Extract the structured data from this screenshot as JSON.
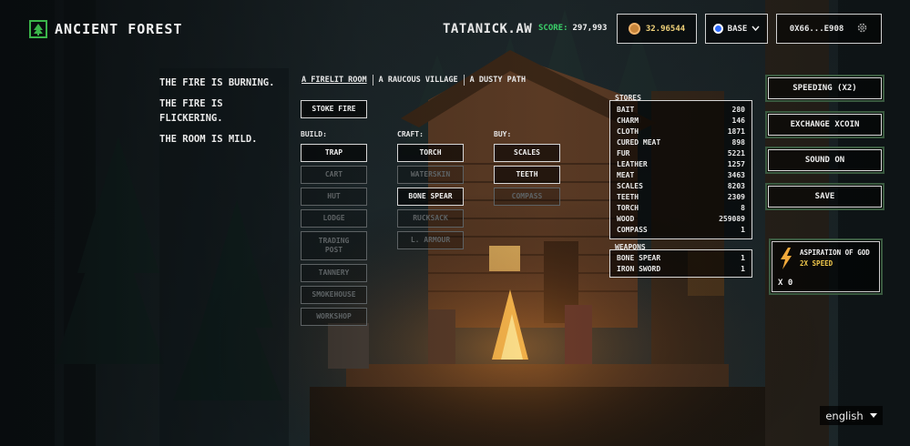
{
  "header": {
    "game_title": "ANCIENT FOREST",
    "username": "TATANICK.AW",
    "score_label": "SCORE:",
    "score_value": "297,993",
    "balance": "32.96544",
    "network": "BASE",
    "wallet": "0X66...E908",
    "icons": {
      "logo": "tree-icon",
      "coin": "coin-icon",
      "network": "base-network-icon",
      "dropdown": "chevron-down-icon",
      "settings": "gear-icon"
    }
  },
  "notes": [
    "THE FIRE IS BURNING.",
    "THE FIRE IS FLICKERING.",
    "THE ROOM IS MILD."
  ],
  "tabs": [
    {
      "label": "A FIRELIT ROOM",
      "active": true
    },
    {
      "label": "A RAUCOUS VILLAGE",
      "active": false
    },
    {
      "label": "A DUSTY PATH",
      "active": false
    }
  ],
  "actions": {
    "stoke_fire": "STOKE FIRE"
  },
  "build": {
    "label": "BUILD:",
    "items": [
      {
        "label": "TRAP",
        "enabled": true
      },
      {
        "label": "CART",
        "enabled": false
      },
      {
        "label": "HUT",
        "enabled": false
      },
      {
        "label": "LODGE",
        "enabled": false
      },
      {
        "label": "TRADING POST",
        "enabled": false
      },
      {
        "label": "TANNERY",
        "enabled": false
      },
      {
        "label": "SMOKEHOUSE",
        "enabled": false
      },
      {
        "label": "WORKSHOP",
        "enabled": false
      }
    ]
  },
  "craft": {
    "label": "CRAFT:",
    "items": [
      {
        "label": "TORCH",
        "enabled": true
      },
      {
        "label": "WATERSKIN",
        "enabled": false
      },
      {
        "label": "BONE SPEAR",
        "enabled": true
      },
      {
        "label": "RUCKSACK",
        "enabled": false
      },
      {
        "label": "L. ARMOUR",
        "enabled": false
      }
    ]
  },
  "buy": {
    "label": "BUY:",
    "items": [
      {
        "label": "SCALES",
        "enabled": true
      },
      {
        "label": "TEETH",
        "enabled": true
      },
      {
        "label": "COMPASS",
        "enabled": false
      }
    ]
  },
  "stores": {
    "title": "STORES",
    "items": [
      {
        "name": "BAIT",
        "qty": "280"
      },
      {
        "name": "CHARM",
        "qty": "146"
      },
      {
        "name": "CLOTH",
        "qty": "1871"
      },
      {
        "name": "CURED MEAT",
        "qty": "898"
      },
      {
        "name": "FUR",
        "qty": "5221"
      },
      {
        "name": "LEATHER",
        "qty": "1257"
      },
      {
        "name": "MEAT",
        "qty": "3463"
      },
      {
        "name": "SCALES",
        "qty": "8203"
      },
      {
        "name": "TEETH",
        "qty": "2309"
      },
      {
        "name": "TORCH",
        "qty": "8"
      },
      {
        "name": "WOOD",
        "qty": "259089"
      },
      {
        "name": "COMPASS",
        "qty": "1"
      }
    ]
  },
  "weapons": {
    "title": "WEAPONS",
    "items": [
      {
        "name": "BONE SPEAR",
        "qty": "1"
      },
      {
        "name": "IRON SWORD",
        "qty": "1"
      }
    ]
  },
  "menu": {
    "speeding": "SPEEDING (X2)",
    "exchange": "EXCHANGE XCOIN",
    "sound": "SOUND ON",
    "save": "SAVE"
  },
  "perk": {
    "title": "ASPIRATION OF GOD",
    "subtitle": "2X SPEED",
    "count": "X 0",
    "icon": "lightning-bolt-icon"
  },
  "language": {
    "selected": "english"
  },
  "colors": {
    "accent_green": "#3bd16a",
    "gold": "#f2c94c",
    "border_green": "#3a5a40"
  }
}
